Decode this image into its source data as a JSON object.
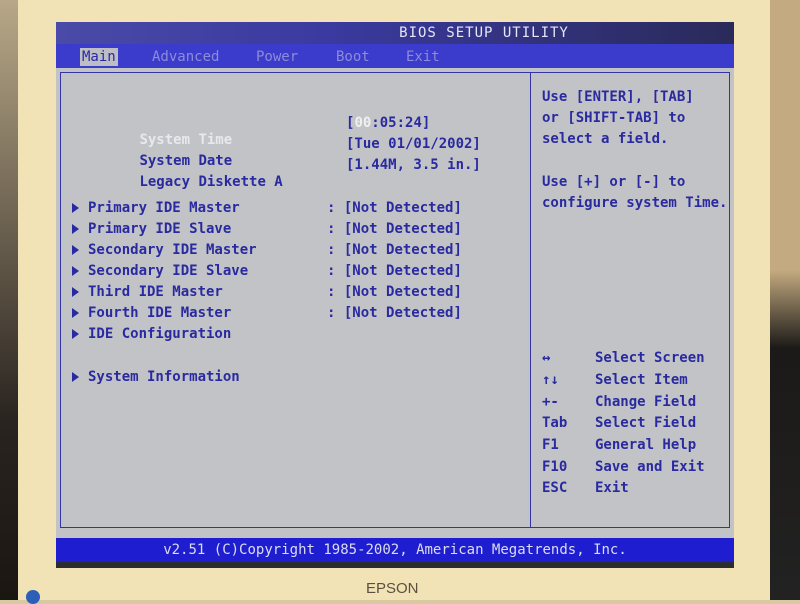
{
  "window": {
    "title": "BIOS SETUP UTILITY"
  },
  "menu": {
    "items": [
      {
        "label": "Main",
        "active": true
      },
      {
        "label": "Advanced",
        "active": false
      },
      {
        "label": "Power",
        "active": false
      },
      {
        "label": "Boot",
        "active": false
      },
      {
        "label": "Exit",
        "active": false
      }
    ]
  },
  "settings": [
    {
      "label": "System Time",
      "value_prefix": "[",
      "value_highlight": "00",
      "value_rest": ":05:24]",
      "selected": true
    },
    {
      "label": "System Date",
      "value": "[Tue 01/01/2002]"
    },
    {
      "label": "Legacy Diskette A",
      "value": "[1.44M, 3.5 in.]"
    }
  ],
  "submenus": [
    {
      "label": "Primary IDE Master",
      "separator": ":",
      "value": "[Not Detected]"
    },
    {
      "label": "Primary IDE Slave",
      "separator": ":",
      "value": "[Not Detected]"
    },
    {
      "label": "Secondary IDE Master",
      "separator": ":",
      "value": "[Not Detected]"
    },
    {
      "label": "Secondary IDE Slave",
      "separator": ":",
      "value": "[Not Detected]"
    },
    {
      "label": "Third IDE Master",
      "separator": ":",
      "value": "[Not Detected]"
    },
    {
      "label": "Fourth IDE Master",
      "separator": ":",
      "value": "[Not Detected]"
    },
    {
      "label": "IDE Configuration"
    },
    {
      "label": "System Information"
    }
  ],
  "help": {
    "lines": [
      "Use [ENTER], [TAB]",
      "or [SHIFT-TAB] to",
      "select a field.",
      "",
      "Use [+] or [-] to",
      "configure system Time."
    ],
    "keys": [
      {
        "key": "↔",
        "desc": "Select Screen",
        "icon": "left-right-arrow-icon"
      },
      {
        "key": "↑↓",
        "desc": "Select Item",
        "icon": "up-down-arrow-icon"
      },
      {
        "key": "+-",
        "desc": "Change Field",
        "icon": "plus-minus-icon"
      },
      {
        "key": "Tab",
        "desc": "Select Field"
      },
      {
        "key": "F1",
        "desc": "General Help"
      },
      {
        "key": "F10",
        "desc": "Save and Exit"
      },
      {
        "key": "ESC",
        "desc": "Exit"
      }
    ]
  },
  "footer": {
    "text": "v2.51 (C)Copyright 1985-2002, American Megatrends, Inc."
  },
  "monitor": {
    "brand": "EPSON"
  }
}
